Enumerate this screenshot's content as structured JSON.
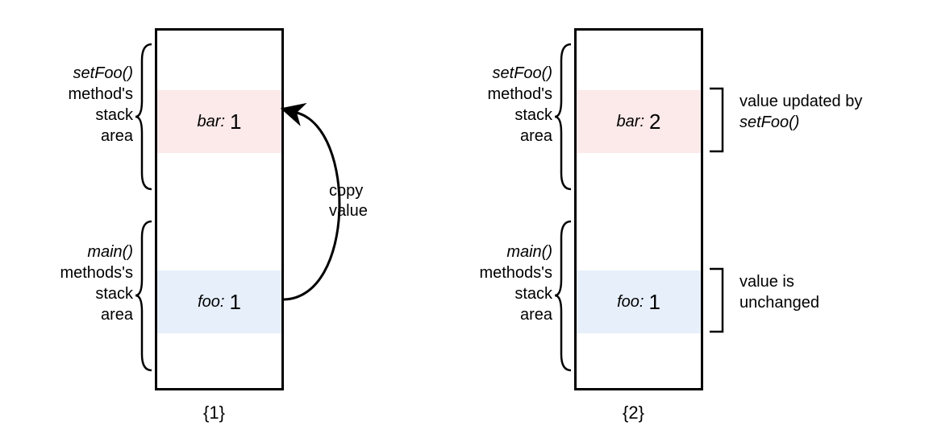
{
  "panel1": {
    "caption": "{1}",
    "top_cell": {
      "var": "bar:",
      "val": "1"
    },
    "bot_cell": {
      "var": "foo:",
      "val": "1"
    },
    "label_top": {
      "method": "setFoo()",
      "l2": "method's",
      "l3": "stack",
      "l4": "area"
    },
    "label_bot": {
      "method": "main()",
      "l2": "methods's",
      "l3": "stack",
      "l4": "area"
    },
    "arrow": {
      "l1": "copy",
      "l2": "value"
    }
  },
  "panel2": {
    "caption": "{2}",
    "top_cell": {
      "var": "bar:",
      "val": "2"
    },
    "bot_cell": {
      "var": "foo:",
      "val": "1"
    },
    "label_top": {
      "method": "setFoo()",
      "l2": "method's",
      "l3": "stack",
      "l4": "area"
    },
    "label_bot": {
      "method": "main()",
      "l2": "methods's",
      "l3": "stack",
      "l4": "area"
    },
    "note_top": {
      "part1": "value updated by ",
      "method": "setFoo()"
    },
    "note_bot": {
      "l1": "value is",
      "l2": "unchanged"
    }
  }
}
